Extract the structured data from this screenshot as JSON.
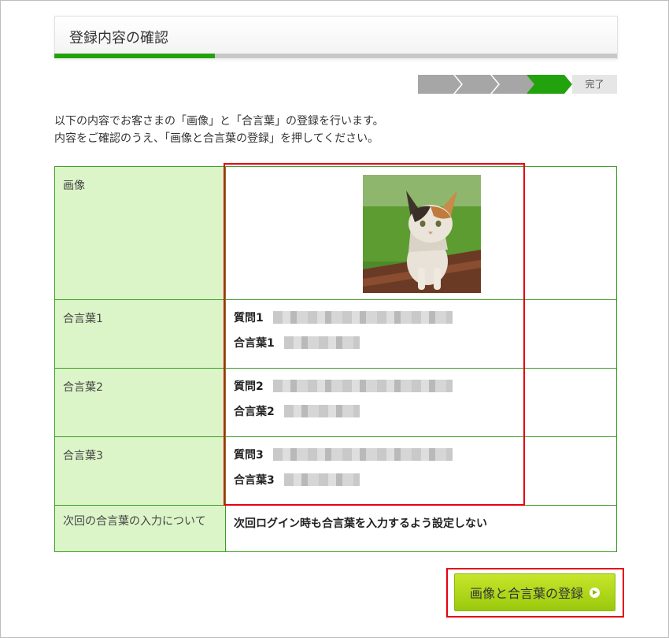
{
  "header": {
    "title": "登録内容の確認",
    "progress": 0.286
  },
  "steps": {
    "done_label": "完了",
    "current_index": 3,
    "count": 4
  },
  "intro": {
    "line1": "以下の内容でお客さまの「画像」と「合言葉」の登録を行います。",
    "line2": "内容をご確認のうえ、「画像と合言葉の登録」を押してください。"
  },
  "table": {
    "image_label": "画像",
    "rows": [
      {
        "label": "合言葉1",
        "question_label": "質問1",
        "answer_label": "合言葉1"
      },
      {
        "label": "合言葉2",
        "question_label": "質問2",
        "answer_label": "合言葉2"
      },
      {
        "label": "合言葉3",
        "question_label": "質問3",
        "answer_label": "合言葉3"
      }
    ],
    "next_label": "次回の合言葉の入力について",
    "next_value": "次回ログイン時も合言葉を入力するよう設定しない"
  },
  "submit": {
    "label": "画像と合言葉の登録"
  },
  "colors": {
    "accent_green": "#22a20c",
    "highlight_red": "#e60012",
    "label_bg": "#dcf5c8",
    "button_green": "#9ac90d"
  }
}
